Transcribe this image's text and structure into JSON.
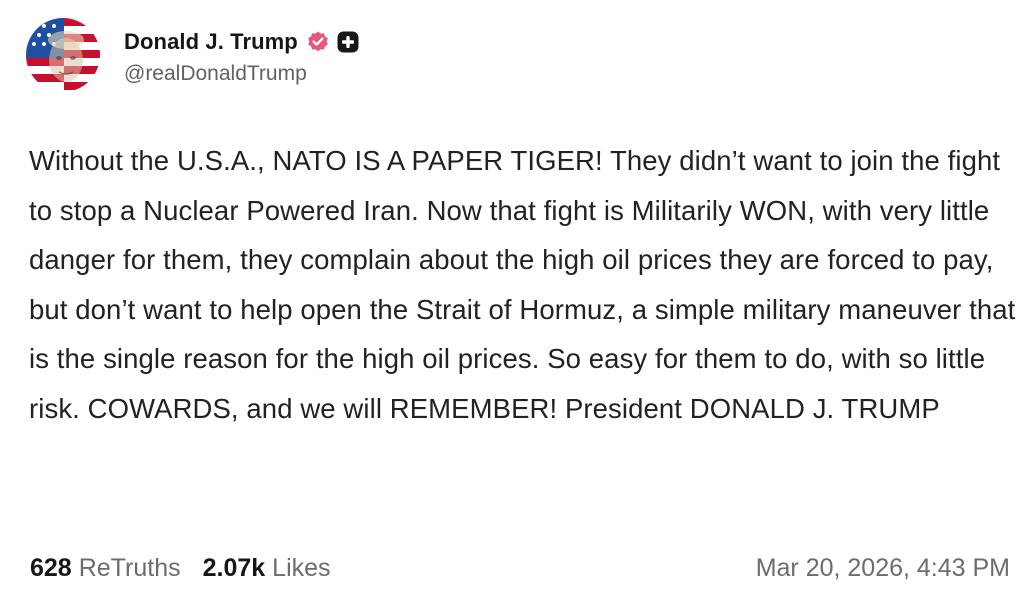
{
  "author": {
    "display_name": "Donald J. Trump",
    "handle": "@realDonaldTrump",
    "avatar_icon": "flag-portrait-avatar",
    "verified_icon": "verified-badge-icon",
    "verified_color": "#e8567a",
    "badge_icon": "plus-badge-icon"
  },
  "post": {
    "text": "Without the U.S.A., NATO IS A PAPER TIGER! They didn’t want to join the fight to stop a Nuclear Powered Iran. Now that fight is Militarily WON, with very little danger for them, they complain about the high oil prices they are forced to pay, but don’t want to help open the Strait of Hormuz, a simple military maneuver that is the single reason for the high oil prices. So easy for them to do, with so little risk. COWARDS, and we will REMEMBER! President DONALD J. TRUMP"
  },
  "footer": {
    "retruths_count": "628",
    "retruths_label": "ReTruths",
    "likes_count": "2.07k",
    "likes_label": "Likes",
    "timestamp": "Mar 20, 2026, 4:43 PM"
  }
}
